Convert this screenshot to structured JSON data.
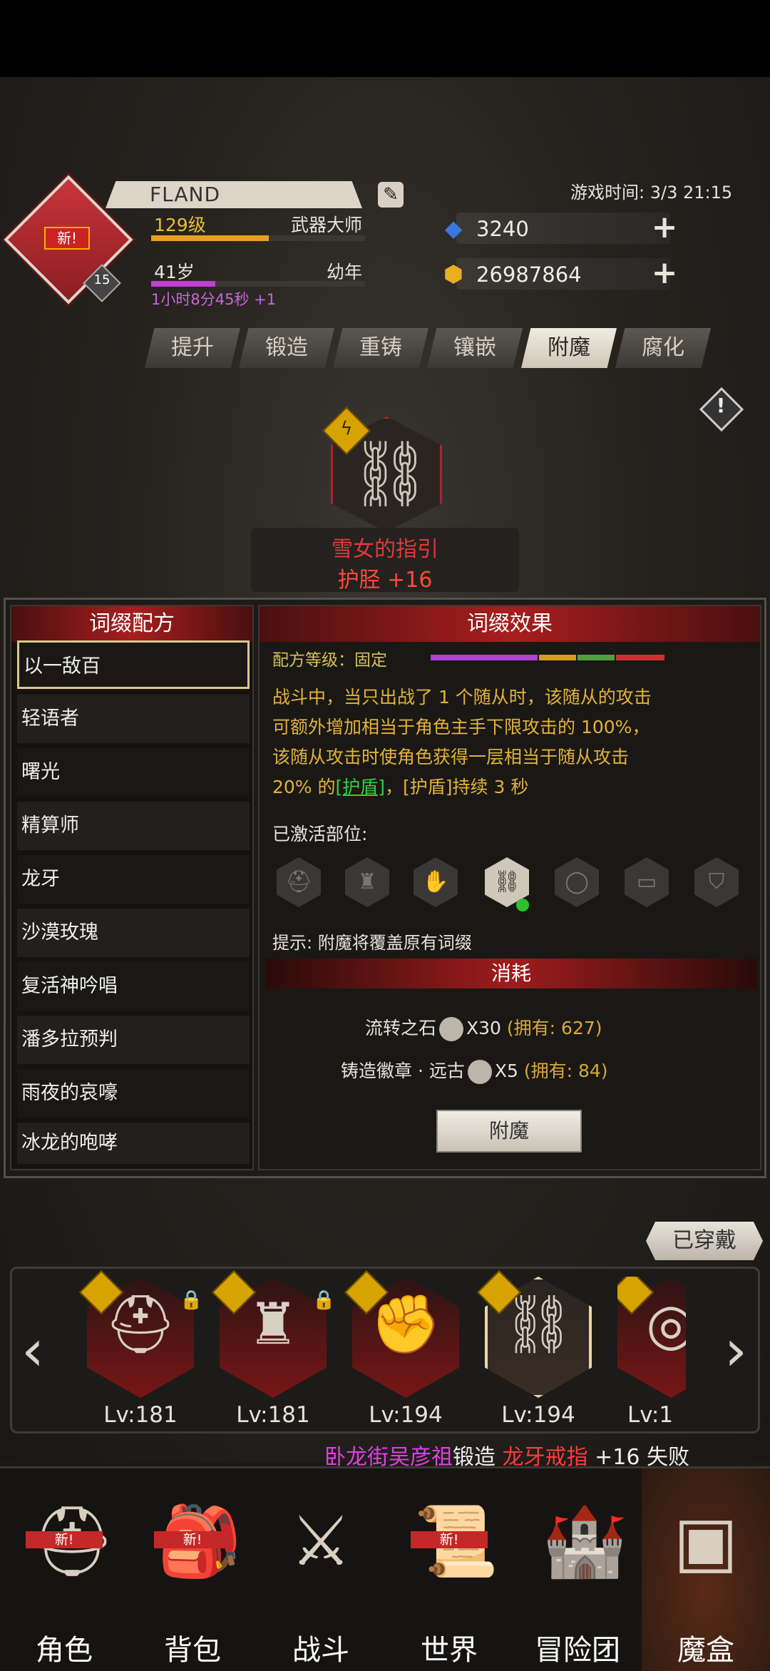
{
  "profile": {
    "name": "FLAND",
    "avatar_badge": "新!",
    "avatar_level": "15",
    "level": "129级",
    "title": "武器大师",
    "age": "41岁",
    "age_stage": "幼年",
    "timer": "1小时8分45秒 +1",
    "level_progress": 0.55,
    "age_progress": 0.3
  },
  "game_time": "游戏时间: 3/3 21:15",
  "currency": {
    "diamond": "3240",
    "gold": "26987864"
  },
  "tabs": [
    "提升",
    "锻造",
    "重铸",
    "镶嵌",
    "附魔",
    "腐化"
  ],
  "active_tab": "附魔",
  "item": {
    "name": "雪女的指引",
    "type": "护胫 +16"
  },
  "recipe_panel": {
    "title": "词缀配方",
    "items": [
      "以一敌百",
      "轻语者",
      "曙光",
      "精算师",
      "龙牙",
      "沙漠玫瑰",
      "复活神吟唱",
      "潘多拉预判",
      "雨夜的哀嚎",
      "冰龙的咆哮"
    ]
  },
  "effect_panel": {
    "title": "词缀效果",
    "level_label": "配方等级：固定",
    "lines": [
      "战斗中，当只出战了 1 个随从时，该随从的攻击",
      "可额外增加相当于角色主手下限攻击的 100%，",
      "该随从攻击时使角色获得一层相当于随从攻击",
      "20% 的"
    ],
    "shield_link": "[护盾]",
    "line4_tail": "，[护盾]持续 3 秒",
    "active_label": "已激活部位:",
    "hint": "提示: 附魔将覆盖原有词缀",
    "level_colors": [
      "#b040d0",
      "#d49a20",
      "#50a040",
      "#d03030"
    ]
  },
  "cost": {
    "title": "消耗",
    "items": [
      {
        "name": "流转之石",
        "qty": "X30",
        "own": "(拥有: 627)"
      },
      {
        "name": "铸造徽章 · 远古",
        "qty": "X5",
        "own": "(拥有: 84)"
      }
    ],
    "button": "附魔"
  },
  "equipped_label": "已穿戴",
  "carousel": [
    {
      "icon": "helmet-icon",
      "level": "Lv:181"
    },
    {
      "icon": "armor-icon",
      "level": "Lv:181"
    },
    {
      "icon": "gauntlet-icon",
      "level": "Lv:194"
    },
    {
      "icon": "greaves-icon",
      "level": "Lv:194"
    },
    {
      "icon": "ring-icon",
      "level": "Lv:1"
    }
  ],
  "ticker": {
    "player": "卧龙街吴彦祖",
    "action": "锻造",
    "item": "龙牙戒指",
    "result": "+16 失败"
  },
  "nav": [
    {
      "label": "角色",
      "badge": "新!",
      "icon": "character-icon"
    },
    {
      "label": "背包",
      "badge": "新!",
      "icon": "backpack-icon"
    },
    {
      "label": "战斗",
      "badge": "",
      "icon": "battle-icon"
    },
    {
      "label": "世界",
      "badge": "新!",
      "icon": "world-icon"
    },
    {
      "label": "冒险团",
      "badge": "",
      "icon": "guild-icon"
    },
    {
      "label": "魔盒",
      "badge": "",
      "icon": "magic-box-icon"
    }
  ]
}
